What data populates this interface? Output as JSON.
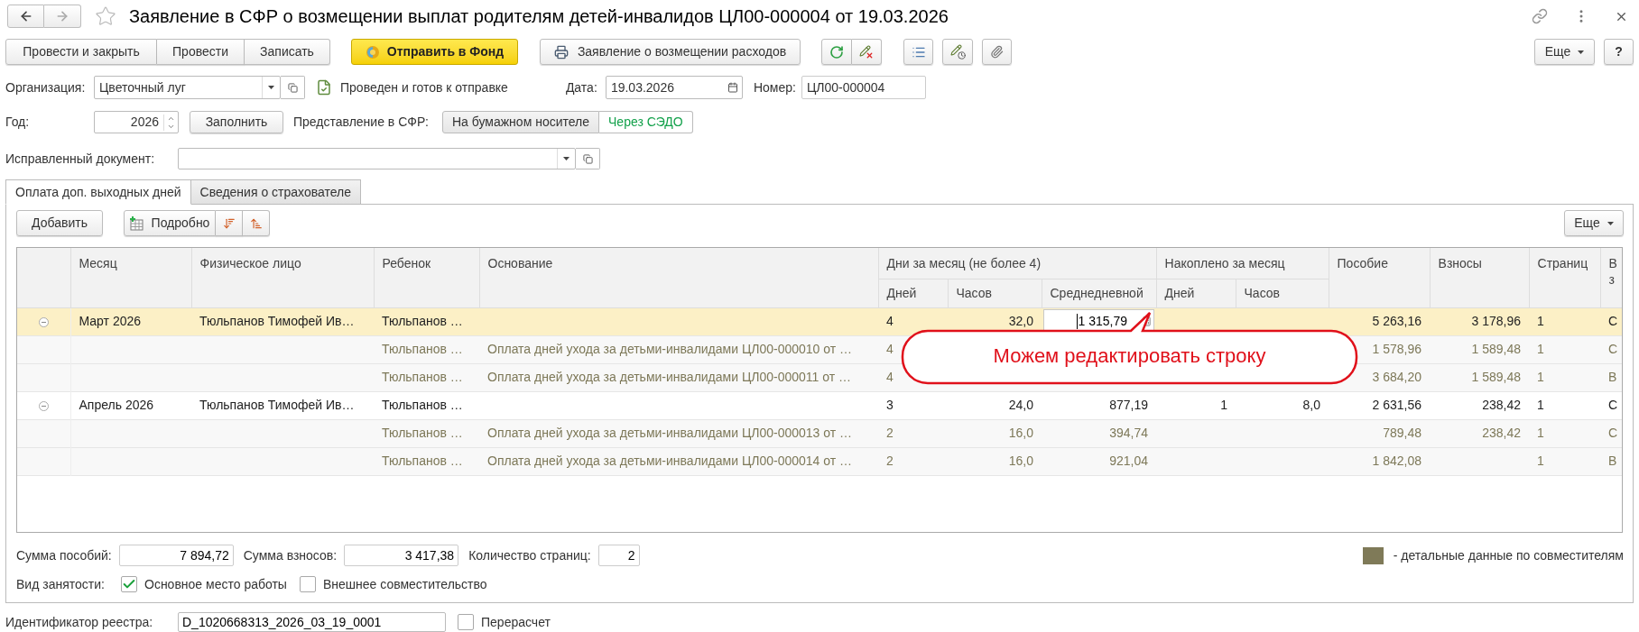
{
  "window": {
    "title": "Заявление в СФР о возмещении выплат родителям детей-инвалидов ЦЛ00-000004 от 19.03.2026"
  },
  "toolbar": {
    "post_buttons": [
      "Провести и закрыть",
      "Провести",
      "Записать"
    ],
    "send_button": "Отправить в Фонд",
    "print_button": "Заявление о возмещении расходов",
    "more_button": "Еще",
    "help_button": "?"
  },
  "form": {
    "organization": {
      "label": "Организация:",
      "value": "Цветочный луг"
    },
    "status": "Проведен и готов к отправке",
    "date": {
      "label": "Дата:",
      "value": "19.03.2026"
    },
    "number": {
      "label": "Номер:",
      "value": "ЦЛ00-000004"
    },
    "year": {
      "label": "Год:",
      "value": "2026"
    },
    "fill_button": "Заполнить",
    "submission": {
      "label": "Представление в СФР:",
      "options": [
        {
          "label": "На бумажном носителе",
          "selected": false
        },
        {
          "label": "Через СЭДО",
          "selected": true
        }
      ]
    },
    "corrected_document": {
      "label": "Исправленный документ:"
    }
  },
  "tabs": [
    {
      "label": "Оплата доп. выходных дней",
      "selected": true
    },
    {
      "label": "Сведения о страхователе",
      "selected": false
    }
  ],
  "table_toolbar": {
    "add_button": "Добавить",
    "details_button": "Подробно",
    "more_button": "Еще"
  },
  "table": {
    "columns": [
      {
        "label": "Месяц"
      },
      {
        "label": "Физическое лицо"
      },
      {
        "label": "Ребенок"
      },
      {
        "label": "Основание"
      },
      {
        "label": "Дни за месяц (не более 4)",
        "colspan": 3,
        "children": [
          {
            "label": "Дней"
          },
          {
            "label": "Часов"
          },
          {
            "label": "Среднедневной"
          }
        ]
      },
      {
        "label": "Накоплено за месяц",
        "colspan": 2,
        "children": [
          {
            "label": "Дней"
          },
          {
            "label": "Часов"
          }
        ]
      },
      {
        "label": "Пособие"
      },
      {
        "label": "Взносы"
      },
      {
        "label": "Страниц"
      },
      {
        "label": "В з"
      }
    ],
    "rows": [
      {
        "kind": "group",
        "selected": true,
        "expanded": true,
        "editing": true,
        "cells": [
          "Март 2026",
          "Тюльпанов Тимофей Ив…",
          "Тюльпанов …",
          null,
          "4",
          "32,0",
          "1 315,79",
          null,
          null,
          "5 263,16",
          "3 178,96",
          "1",
          "С"
        ]
      },
      {
        "kind": "detail",
        "selected": false,
        "cells": [
          null,
          null,
          "Тюльпанов …",
          "Оплата дней ухода за детьми-инвалидами ЦЛ00-000010 от …",
          "4",
          null,
          null,
          null,
          null,
          "1 578,96",
          "1 589,48",
          "1",
          "С"
        ]
      },
      {
        "kind": "detail",
        "selected": false,
        "cells": [
          null,
          null,
          "Тюльпанов …",
          "Оплата дней ухода за детьми-инвалидами ЦЛ00-000011 от …",
          "4",
          null,
          null,
          null,
          null,
          "3 684,20",
          "1 589,48",
          "1",
          "В"
        ]
      },
      {
        "kind": "group",
        "selected": false,
        "expanded": true,
        "editing": false,
        "cells": [
          "Апрель 2026",
          "Тюльпанов Тимофей Ив…",
          "Тюльпанов …",
          null,
          "3",
          "24,0",
          "877,19",
          "1",
          "8,0",
          "2 631,56",
          "238,42",
          "1",
          "С"
        ]
      },
      {
        "kind": "detail",
        "selected": false,
        "cells": [
          null,
          null,
          "Тюльпанов …",
          "Оплата дней ухода за детьми-инвалидами ЦЛ00-000013 от …",
          "2",
          "16,0",
          "394,74",
          null,
          null,
          "789,48",
          "238,42",
          "1",
          "С"
        ]
      },
      {
        "kind": "detail",
        "selected": false,
        "cells": [
          null,
          null,
          "Тюльпанов …",
          "Оплата дней ухода за детьми-инвалидами ЦЛ00-000014 от …",
          "2",
          "16,0",
          "921,04",
          null,
          null,
          "1 842,08",
          null,
          "1",
          "В"
        ]
      }
    ]
  },
  "callout": {
    "text": "Можем редактировать строку"
  },
  "totals": [
    {
      "label": "Сумма пособий:",
      "value": "7 894,72"
    },
    {
      "label": "Сумма взносов:",
      "value": "3 417,38"
    },
    {
      "label": "Количество страниц:",
      "value": "2"
    }
  ],
  "legend": {
    "color": "#7f7a58",
    "text": "- детальные данные по совместителям"
  },
  "employment": {
    "label": "Вид занятости:",
    "options": [
      {
        "label": "Основное место работы",
        "checked": true
      },
      {
        "label": "Внешнее совместительство",
        "checked": false
      }
    ]
  },
  "registry": {
    "label": "Идентификатор реестра:",
    "value": "D_1020668313_2026_03_19_0001",
    "recalc": {
      "label": "Перерасчет",
      "checked": false
    }
  }
}
